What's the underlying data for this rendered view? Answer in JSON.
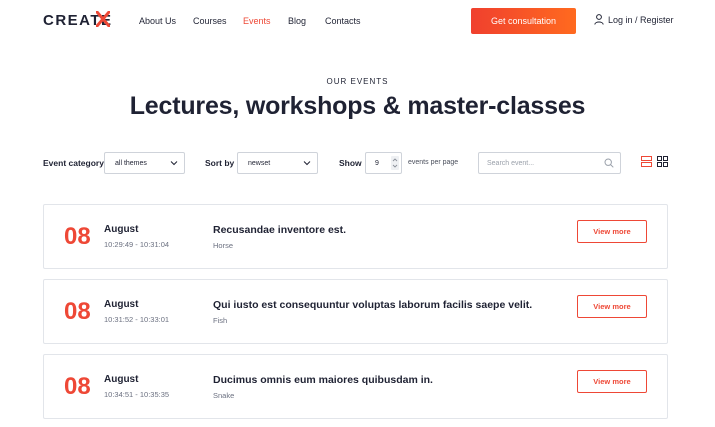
{
  "header": {
    "logo": "CREATE",
    "nav": [
      {
        "label": "About Us",
        "active": false
      },
      {
        "label": "Courses",
        "active": false
      },
      {
        "label": "Events",
        "active": true
      },
      {
        "label": "Blog",
        "active": false
      },
      {
        "label": "Contacts",
        "active": false
      }
    ],
    "cta_label": "Get consultation",
    "login_label": "Log in / Register"
  },
  "hero": {
    "eyebrow": "OUR EVENTS",
    "title": "Lectures, workshops & master-classes"
  },
  "filters": {
    "category_label": "Event category",
    "category_value": "all themes",
    "sort_label": "Sort by",
    "sort_value": "newset",
    "show_label": "Show",
    "show_value": "9",
    "per_page_label": "events per page",
    "search_placeholder": "Search event..."
  },
  "events": [
    {
      "day": "08",
      "month": "August",
      "time": "10:29:49 - 10:31:04",
      "title": "Recusandae inventore est.",
      "category": "Horse",
      "button": "View more"
    },
    {
      "day": "08",
      "month": "August",
      "time": "10:31:52 - 10:33:01",
      "title": "Qui iusto est consequuntur voluptas laborum facilis saepe velit.",
      "category": "Fish",
      "button": "View more"
    },
    {
      "day": "08",
      "month": "August",
      "time": "10:34:51 - 10:35:35",
      "title": "Ducimus omnis eum maiores quibusdam in.",
      "category": "Snake",
      "button": "View more"
    }
  ],
  "colors": {
    "accent": "#ee4836",
    "accent_gradient_end": "#ff6a1f",
    "text_dark": "#1f2233",
    "border": "#e2e5ea"
  },
  "icons": {
    "logo_mark": "x-mark-icon",
    "login": "user-icon",
    "search": "search-icon",
    "list_view": "list-view-icon",
    "grid_view": "grid-view-icon",
    "select": "chevron-down-icon",
    "stepper": "stepper-arrows-icon"
  }
}
